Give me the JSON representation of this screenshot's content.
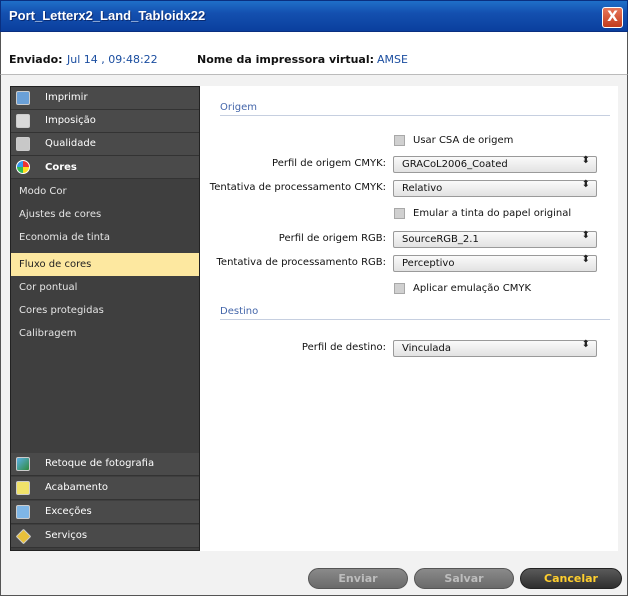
{
  "window": {
    "title": "Port_Letterx2_Land_Tabloidx22",
    "close_label": "X"
  },
  "info": {
    "sent_label": "Enviado:",
    "sent_value": "Jul 14 , 09:48:22",
    "printer_label": "Nome da impressora virtual:",
    "printer_value": "AMSE"
  },
  "sidebar": {
    "top_items": [
      {
        "label": "Imprimir",
        "icon": "printer-icon"
      },
      {
        "label": "Imposição",
        "icon": "imposition-icon"
      },
      {
        "label": "Qualidade",
        "icon": "quality-icon"
      },
      {
        "label": "Cores",
        "icon": "color-wheel-icon"
      }
    ],
    "sub_items": [
      {
        "label": "Modo Cor"
      },
      {
        "label": "Ajustes de cores"
      },
      {
        "label": "Economia de tinta"
      },
      {
        "label": "Fluxo de cores",
        "active": true
      },
      {
        "label": "Cor pontual"
      },
      {
        "label": "Cores protegidas"
      },
      {
        "label": "Calibragem"
      }
    ],
    "bottom_items": [
      {
        "label": "Retoque de fotografia",
        "icon": "photo-retouch-icon"
      },
      {
        "label": "Acabamento",
        "icon": "finishing-icon"
      },
      {
        "label": "Exceções",
        "icon": "exceptions-icon"
      },
      {
        "label": "Serviços",
        "icon": "services-icon"
      }
    ]
  },
  "main": {
    "origem_title": "Origem",
    "destino_title": "Destino",
    "use_csa_label": "Usar CSA de origem",
    "cmyk_profile_label": "Perfil de origem CMYK:",
    "cmyk_profile_value": "GRACoL2006_Coated",
    "cmyk_intent_label": "Tentativa de processamento CMYK:",
    "cmyk_intent_value": "Relativo",
    "emulate_paper_label": "Emular a tinta do papel original",
    "rgb_profile_label": "Perfil de origem RGB:",
    "rgb_profile_value": "SourceRGB_2.1",
    "rgb_intent_label": "Tentativa de processamento RGB:",
    "rgb_intent_value": "Perceptivo",
    "cmyk_emulation_label": "Aplicar emulação CMYK",
    "dest_profile_label": "Perfil de destino:",
    "dest_profile_value": "Vinculada",
    "select_arrow": "⬍"
  },
  "footer": {
    "send_label": "Enviar",
    "save_label": "Salvar",
    "cancel_label": "Cancelar"
  }
}
